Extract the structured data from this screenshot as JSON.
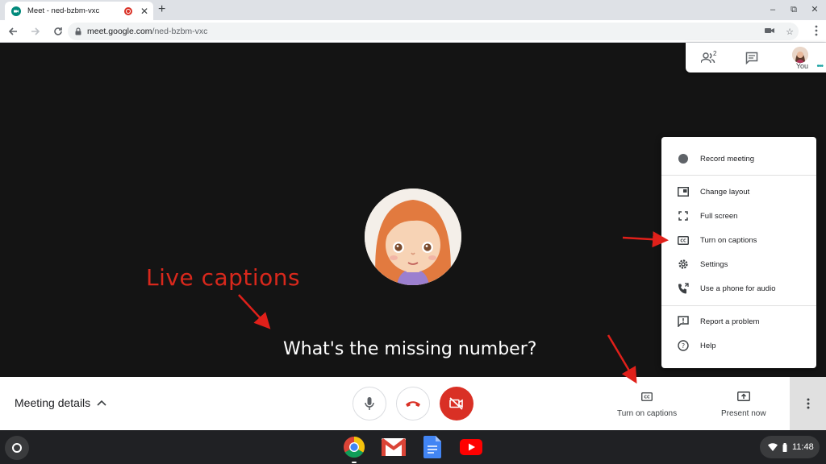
{
  "browser": {
    "tab_title": "Meet - ned-bzbm-vxc",
    "url_host": "meet.google.com",
    "url_path": "/ned-bzbm-vxc"
  },
  "meet": {
    "participant_count": "2",
    "self_label": "You",
    "annotation_label": "Live captions",
    "caption_text": "What's the missing number?",
    "menu": {
      "record_meeting": "Record meeting",
      "change_layout": "Change layout",
      "full_screen": "Full screen",
      "turn_on_captions": "Turn on captions",
      "settings": "Settings",
      "use_phone": "Use a phone for audio",
      "report_problem": "Report a problem",
      "help": "Help"
    },
    "bottom_bar": {
      "meeting_details": "Meeting details",
      "captions_label": "Turn on captions",
      "present_label": "Present now"
    }
  },
  "shelf": {
    "time": "11:48"
  },
  "colors": {
    "annotation_red": "#d8281c",
    "end_call_red": "#d93025",
    "stage_bg": "#141414"
  }
}
